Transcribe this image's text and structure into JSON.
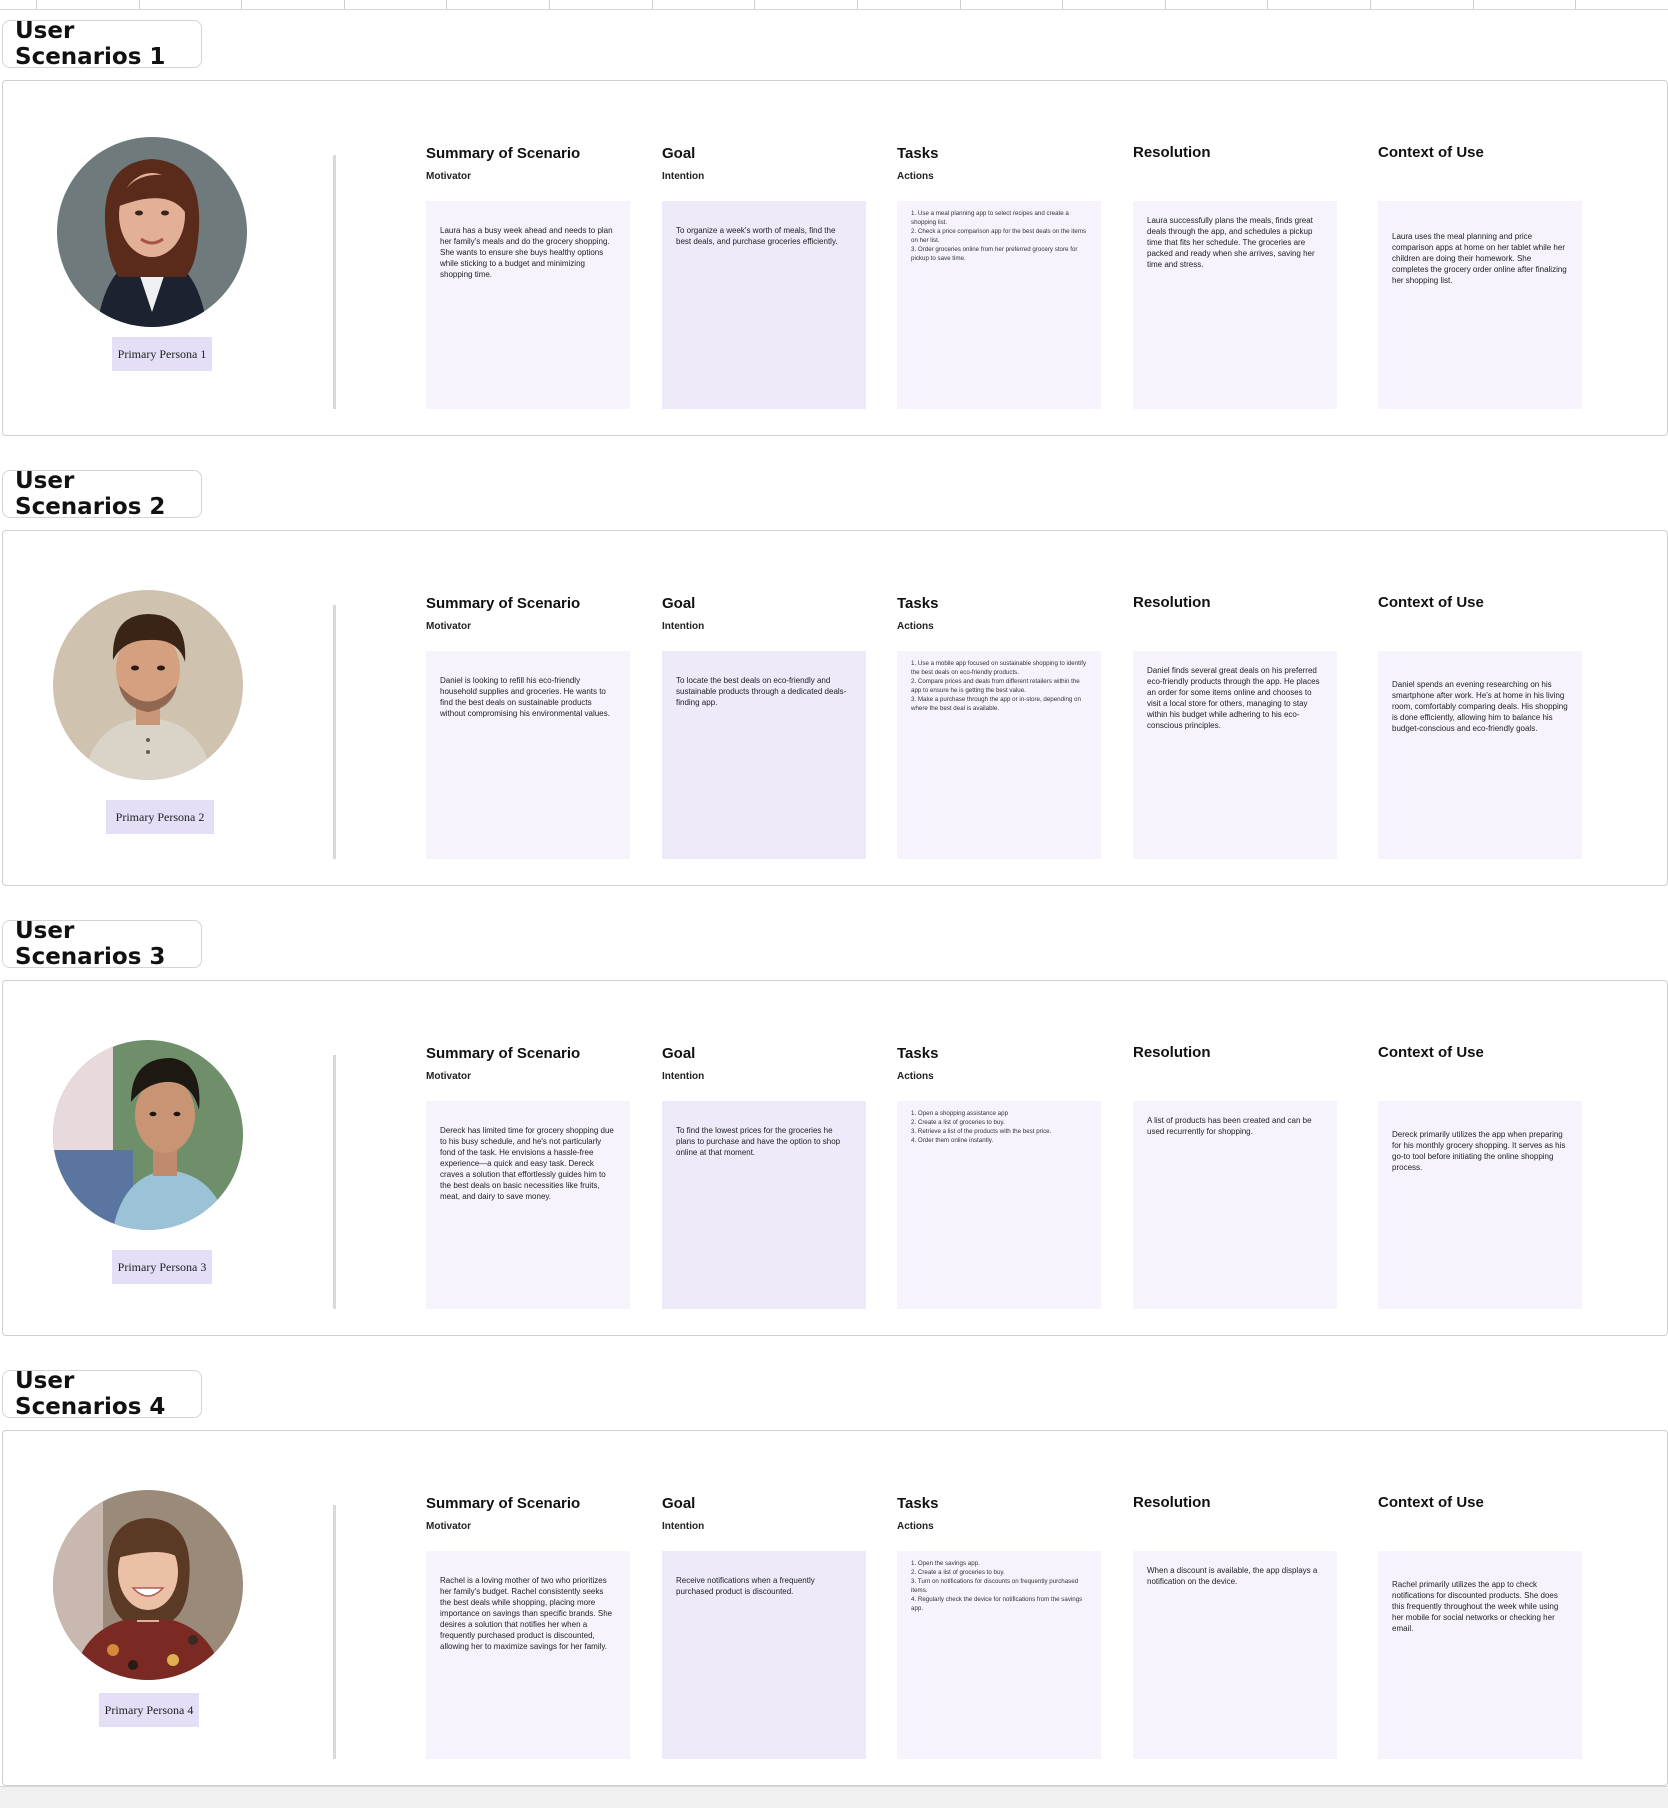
{
  "columns": [
    {
      "title": "Summary of Scenario",
      "sub": "Motivator"
    },
    {
      "title": "Goal",
      "sub": "Intention"
    },
    {
      "title": "Tasks",
      "sub": "Actions"
    },
    {
      "title": "Resolution",
      "sub": ""
    },
    {
      "title": "Context of Use",
      "sub": ""
    }
  ],
  "scenarios": [
    {
      "label": "User Scenarios 1",
      "persona": "Primary Persona 1",
      "summary": "Laura has a busy week ahead and needs to plan her family's meals and do the grocery shopping. She wants to ensure she buys healthy options while sticking to a budget and minimizing shopping time.",
      "goal": "To organize a week's worth of meals, find the best deals, and purchase groceries efficiently.",
      "tasks": [
        "1. Use a meal planning app to select recipes and create a shopping list.",
        "2. Check a price comparison app for the best deals on the items on her list.",
        "3. Order groceries online from her preferred grocery store for pickup to save time."
      ],
      "resolution": "Laura successfully plans the meals, finds great deals through the app, and schedules a pickup time that fits her schedule. The groceries are packed and ready when she arrives, saving her time and stress.",
      "context": "Laura uses the meal planning and price comparison apps at home on her tablet while her children are doing their homework. She completes the grocery order online after finalizing her shopping list."
    },
    {
      "label": "User Scenarios 2",
      "persona": "Primary Persona 2",
      "summary": "Daniel is looking to refill his eco-friendly household supplies and groceries. He wants to find the best deals on sustainable products without compromising his environmental values.",
      "goal": "To locate the best deals on eco-friendly and sustainable products through a dedicated deals-finding app.",
      "tasks": [
        "1. Use a mobile app focused on sustainable shopping to identify the best deals on eco-friendly products.",
        "2. Compare prices and deals from different retailers within the app to ensure he is getting the best value.",
        "3. Make a purchase through the app or in-store, depending on where the best deal is available."
      ],
      "resolution": "Daniel finds several great deals on his preferred eco-friendly products through the app. He places an order for some items online and chooses to visit a local store for others, managing to stay within his budget while adhering to his eco-conscious principles.",
      "context": "Daniel spends an evening researching on his smartphone after work. He's at home in his living room, comfortably comparing deals. His shopping is done efficiently, allowing him to balance his budget-conscious and eco-friendly goals."
    },
    {
      "label": "User Scenarios 3",
      "persona": "Primary Persona 3",
      "summary": "Dereck has limited time for grocery shopping due to his busy schedule, and he's not particularly fond of the task. He envisions a hassle-free experience—a quick and easy task. Dereck craves a solution that effortlessly guides him to the best deals on basic necessities like fruits, meat, and dairy to save money.",
      "goal": "To find the lowest prices for the groceries he plans to purchase and have the option to shop online at that moment.",
      "tasks": [
        "1. Open a shopping assistance app",
        "2. Create a list of groceries to buy.",
        "3. Retrieve a list of the products with the best price.",
        "4. Order them online instantly."
      ],
      "resolution": "A list of products has been created and can be used recurrently for shopping.",
      "context": "Dereck primarily utilizes the app when preparing for his monthly grocery shopping. It serves as his go-to tool before initiating the online shopping process."
    },
    {
      "label": "User Scenarios 4",
      "persona": "Primary Persona 4",
      "summary": "Rachel is a loving mother of two who prioritizes her family's budget. Rachel consistently seeks the best deals while shopping, placing more importance on savings than specific brands. She desires a solution that notifies her when a frequently purchased product is discounted, allowing her to maximize savings for her family.",
      "goal": "Receive notifications when a frequently purchased product is discounted.",
      "tasks": [
        "1. Open the savings app.",
        "2. Create a list of groceries to buy.",
        "3. Turn on notifications for discounts on frequently purchased items.",
        "4. Regularly check the device for notifications from the savings app."
      ],
      "resolution": "When a discount is available, the app displays a notification on the device.",
      "context": "Rachel primarily utilizes the app to check notifications for discounted products. She does this frequently throughout the week while using her mobile for social networks or checking her email."
    }
  ]
}
